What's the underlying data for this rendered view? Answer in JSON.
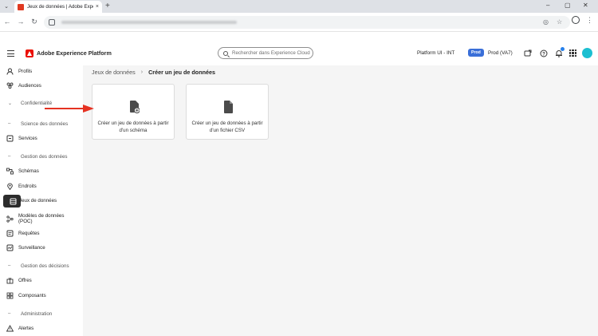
{
  "browser": {
    "tab_title": "Jeux de données | Adobe Expe",
    "new_tab_symbol": "+",
    "close_symbol": "×"
  },
  "app": {
    "title": "Adobe Experience Platform",
    "search_placeholder": "Rechercher dans Experience Cloud ...",
    "org_name": "Platform UI - INT",
    "sandbox_badge": "Prod",
    "sandbox_name": "Prod (VA7)"
  },
  "sidebar": {
    "items": [
      {
        "label": "Profils",
        "icon": "profile-icon"
      },
      {
        "label": "Audiences",
        "icon": "audiences-icon"
      },
      {
        "label": "Confidentialité",
        "type": "section"
      },
      {
        "label": "Science des données",
        "type": "section"
      },
      {
        "label": "Services",
        "icon": "services-icon"
      },
      {
        "label": "Gestion des données",
        "type": "section"
      },
      {
        "label": "Schémas",
        "icon": "schema-icon"
      },
      {
        "label": "Endroits",
        "icon": "location-icon"
      },
      {
        "label": "Jeux de données",
        "icon": "dataset-icon",
        "active": true
      },
      {
        "label": "Modèles de données (POC)",
        "icon": "data-model-icon"
      },
      {
        "label": "Requêtes",
        "icon": "queries-icon"
      },
      {
        "label": "Surveillance",
        "icon": "monitoring-icon"
      },
      {
        "label": "Gestion des décisions",
        "type": "section"
      },
      {
        "label": "Offres",
        "icon": "offers-icon"
      },
      {
        "label": "Composants",
        "icon": "components-icon"
      },
      {
        "label": "Administration",
        "type": "section"
      },
      {
        "label": "Alertes",
        "icon": "alert-icon"
      }
    ]
  },
  "breadcrumb": {
    "parent": "Jeux de données",
    "separator": "›",
    "current": "Créer un jeu de données"
  },
  "cards": [
    {
      "label": "Créer un jeu de données à partir d'un schéma",
      "icon": "create-from-schema-icon"
    },
    {
      "label": "Créer un jeu de données à partir d'un fichier CSV",
      "icon": "file-icon"
    }
  ],
  "colors": {
    "accent_blue": "#3a6fd8",
    "adobe_red": "#eb1000",
    "annotation_arrow": "#e53222",
    "active_nav": "#2c2c2c"
  }
}
